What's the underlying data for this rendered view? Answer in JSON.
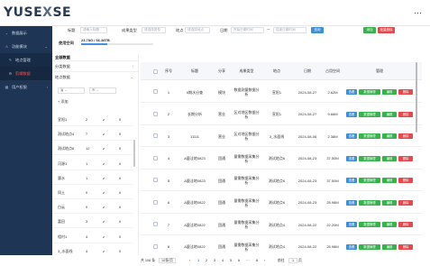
{
  "app": {
    "logo_main": "YUSE",
    "logo_x": "X",
    "logo_end": "SE",
    "more_icon": "⋯"
  },
  "sidebar": {
    "items": [
      {
        "label": "数据展示",
        "icon": "⌄",
        "arrow": ""
      },
      {
        "label": "功能模块",
        "icon": "⚠",
        "arrow": "⌄"
      },
      {
        "label": "地点管理",
        "icon": "✎",
        "arrow": ""
      },
      {
        "label": "剪辑数据",
        "icon": "⚙",
        "arrow": ""
      },
      {
        "label": "用户权限",
        "icon": "▦",
        "arrow": "‹"
      }
    ]
  },
  "filter": {
    "label_1": "标题",
    "placeholder_1": "请输入标题",
    "label_2": "成果类型",
    "placeholder_2": "请选择类型",
    "label_3": "地点",
    "placeholder_3": "请选择地点",
    "label_4": "日期",
    "date_start": "开始日期时间",
    "date_sep": "一",
    "date_end": "结束日期时间",
    "search_btn": "查询",
    "add_btn": "添加",
    "batch_delete_btn": "批量删除"
  },
  "usage": {
    "label": "使用空间",
    "value": "23.78G / 66.38TB",
    "fraction": 0.36
  },
  "left_panel": {
    "all_data": "全部数据",
    "classify": "分类数据",
    "location": "地点数据",
    "select_1": "省",
    "select_2": "市",
    "add": "+ 添加",
    "rows": [
      {
        "name": "宣阳1",
        "a": "2",
        "b": "z",
        "c": "0"
      },
      {
        "name": "测试地点4",
        "a": "7",
        "b": "z",
        "c": "0"
      },
      {
        "name": "测试地点6",
        "a": "12",
        "b": "z",
        "c": "0"
      },
      {
        "name": "河源1",
        "a": "1",
        "c": "0",
        "b": "z"
      },
      {
        "name": "惠水",
        "a": "1",
        "b": "z",
        "c": "0"
      },
      {
        "name": "同土",
        "a": "0",
        "b": "z",
        "c": "0"
      },
      {
        "name": "白云",
        "a": "0",
        "b": "z",
        "c": "0"
      },
      {
        "name": "富田",
        "a": "3",
        "b": "z",
        "c": "0"
      },
      {
        "name": "相村1",
        "a": "4",
        "b": "z",
        "c": "0"
      },
      {
        "name": "3_水面线",
        "a": "4",
        "b": "z",
        "c": "0"
      }
    ]
  },
  "table": {
    "headers": [
      "序号",
      "标题",
      "分享",
      "成果类型",
      "地点",
      "日期",
      "占用空间",
      "管理"
    ],
    "actions": {
      "view": "查看",
      "manage": "数据管理",
      "edit": "编辑",
      "delete": "删除"
    },
    "rows": [
      {
        "no": "1",
        "title": "II期水分查",
        "share": "模块",
        "type": "数据测量数据分析",
        "loc": "宣阳1",
        "date": "2024-08-27",
        "size": "2.62M"
      },
      {
        "no": "2",
        "title": "长期分析",
        "share": "营业",
        "type": "区对地区数据分析",
        "loc": "宣阳1",
        "date": "2024-08-27",
        "size": "9.66M"
      },
      {
        "no": "3",
        "title": "11111",
        "share": "营业",
        "type": "区对地区数据分析",
        "loc": "3_水面线",
        "date": "2024-08-06",
        "size": "2.38M"
      },
      {
        "no": "4",
        "title": "A量洼地0823",
        "share": "团通",
        "type": "量需数据采集分析",
        "loc": "测试地点6",
        "date": "2024-08-23",
        "size": "37.50M"
      },
      {
        "no": "5",
        "title": "A量洼地0823",
        "share": "团通",
        "type": "量需数据采集分析",
        "loc": "测试地点6",
        "date": "2024-08-23",
        "size": "37.50M"
      },
      {
        "no": "6",
        "title": "A量洼地0822",
        "share": "团通",
        "type": "量需数据采集分析",
        "loc": "测试地点6",
        "date": "2024-08-23",
        "size": "25.98M"
      },
      {
        "no": "7",
        "title": "A量洼地0822",
        "share": "团通",
        "type": "量需数据采集分析",
        "loc": "测试地点4",
        "date": "2024-08-22",
        "size": "22.20M"
      },
      {
        "no": "8",
        "title": "A量洼地0822",
        "share": "团通",
        "type": "量需数据采集分析",
        "loc": "测试地点4",
        "date": "2024-08-22",
        "size": "25.98M"
      }
    ]
  },
  "pager": {
    "total": "共 106 条",
    "page_size": "10条/页",
    "prev": "‹",
    "pages": [
      "1",
      "2",
      "3",
      "4",
      "5",
      "6",
      "···",
      "8"
    ],
    "next": "›",
    "goto_label": "前往",
    "goto_value": "1",
    "goto_unit": "页"
  },
  "colors": {
    "sidebar": "#1e3556",
    "primary": "#3f8fd4",
    "success": "#37b24d",
    "danger": "#e5484d"
  }
}
